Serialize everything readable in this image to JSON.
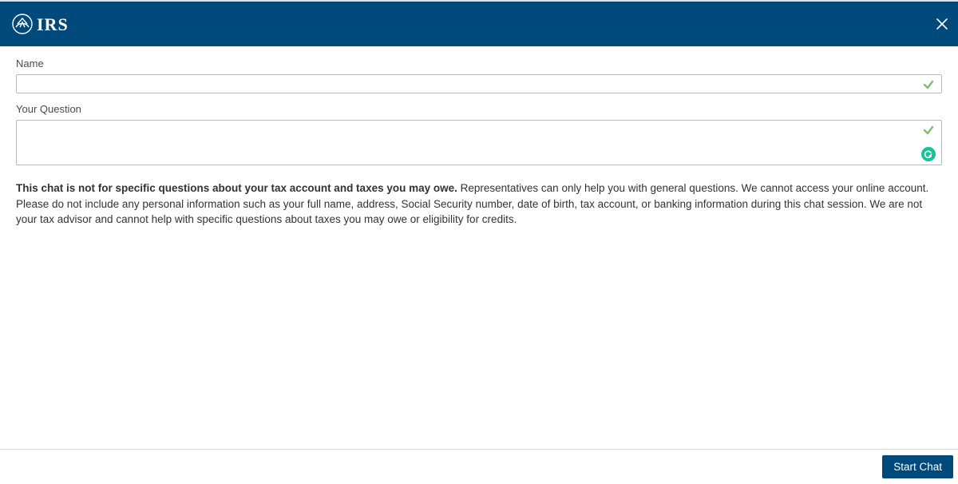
{
  "header": {
    "brand": "IRS",
    "close_label": "Close"
  },
  "form": {
    "name_label": "Name",
    "name_value": "",
    "question_label": "Your Question",
    "question_value": ""
  },
  "info": {
    "bold": "This chat is not for specific questions about your tax account and taxes you may owe.",
    "rest": " Representatives can only help you with general questions. We cannot access your online account. Please do not include any personal information such as your full name, address, Social Security number, date of birth, tax account, or banking information during this chat session. We are not your tax advisor and cannot help with specific questions about taxes you may owe or eligibility for credits."
  },
  "footer": {
    "start_label": "Start Chat"
  },
  "colors": {
    "header_bg": "#00497b",
    "check_green": "#7bc26a",
    "grammarly_green": "#15c39a"
  }
}
